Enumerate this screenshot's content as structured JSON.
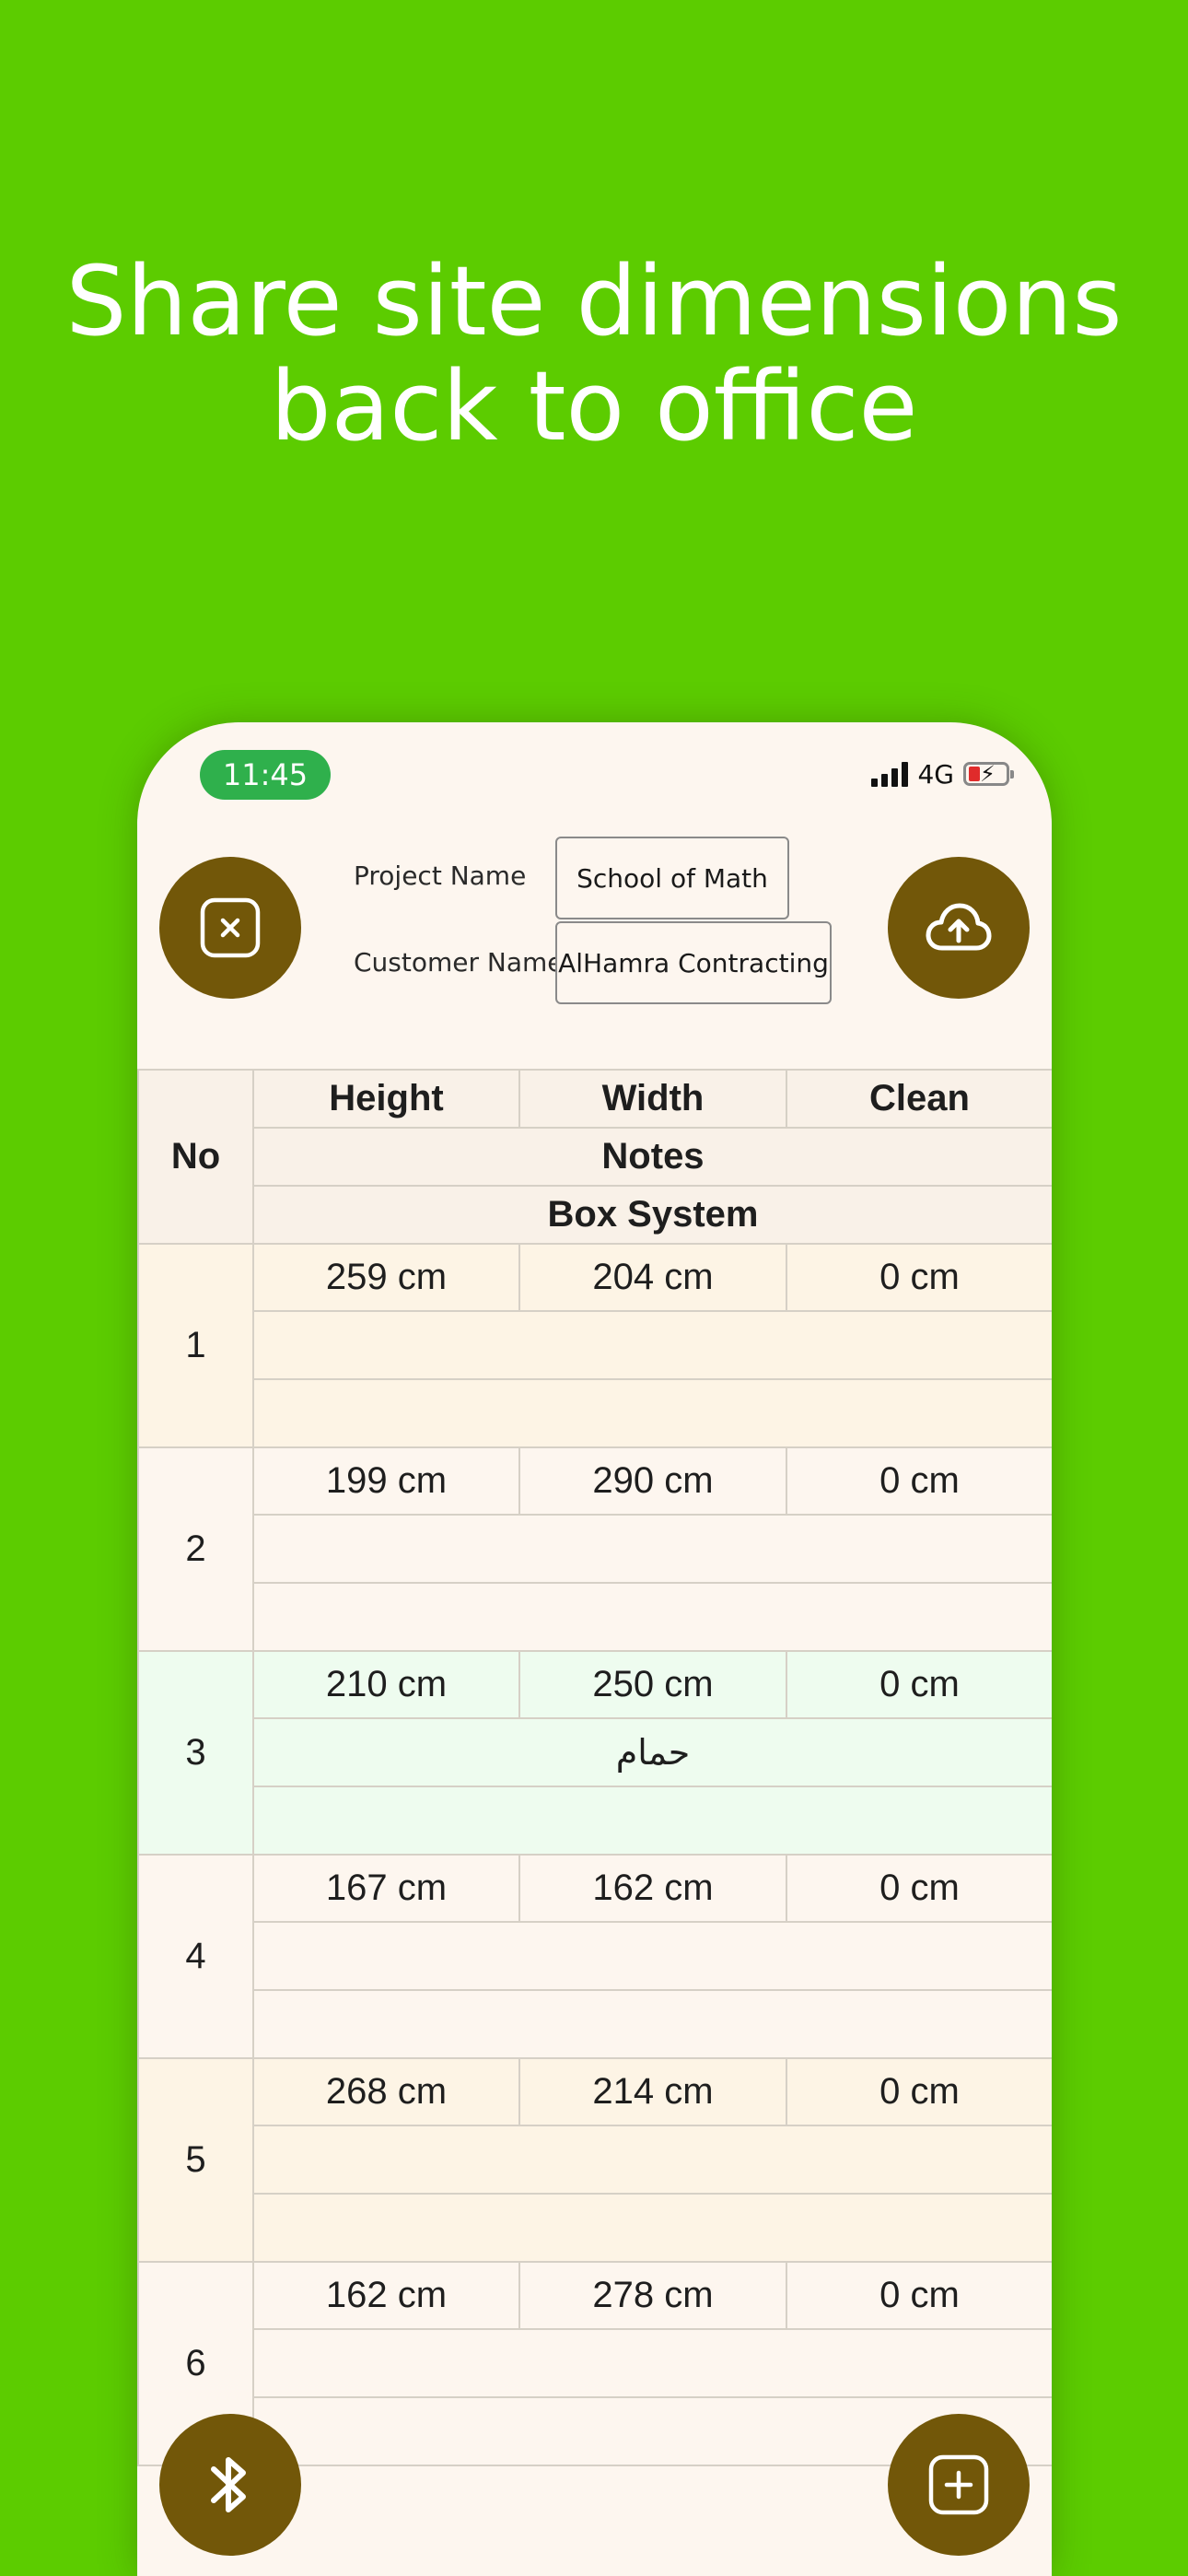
{
  "headline": {
    "line1": "Share site dimensions",
    "line2": "back to office"
  },
  "status": {
    "time": "11:45",
    "network": "4G"
  },
  "form": {
    "project_label": "Project Name",
    "project_value": "School of Math",
    "customer_label": "Customer Name",
    "customer_value": "AlHamra Contracting"
  },
  "table": {
    "headers": {
      "no": "No",
      "height": "Height",
      "width": "Width",
      "clean": "Clean",
      "notes": "Notes",
      "system": "Box System"
    },
    "rows": [
      {
        "no": "1",
        "height": "259 cm",
        "width": "204 cm",
        "clean": "0 cm",
        "note": ""
      },
      {
        "no": "2",
        "height": "199 cm",
        "width": "290 cm",
        "clean": "0 cm",
        "note": ""
      },
      {
        "no": "3",
        "height": "210 cm",
        "width": "250 cm",
        "clean": "0 cm",
        "note": "حمام"
      },
      {
        "no": "4",
        "height": "167 cm",
        "width": "162 cm",
        "clean": "0 cm",
        "note": ""
      },
      {
        "no": "5",
        "height": "268 cm",
        "width": "214 cm",
        "clean": "0 cm",
        "note": ""
      },
      {
        "no": "6",
        "height": "162 cm",
        "width": "278 cm",
        "clean": "0 cm",
        "note": ""
      }
    ]
  },
  "icons": {
    "close": "close-square-icon",
    "upload": "cloud-upload-icon",
    "bluetooth": "bluetooth-icon",
    "add": "add-square-icon"
  },
  "colors": {
    "background": "#5ccc00",
    "button": "#725709",
    "time_pill": "#2fb04c"
  }
}
